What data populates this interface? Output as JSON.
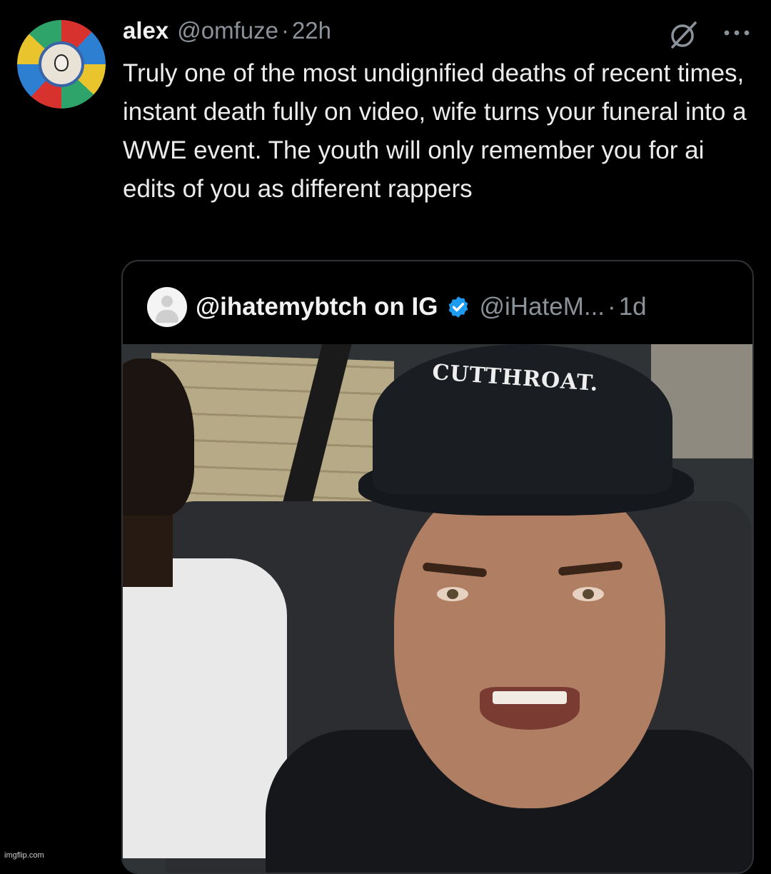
{
  "tweet": {
    "name": "alex",
    "handle": "@omfuze",
    "separator": "·",
    "time": "22h",
    "text": "Truly one of the most undignified deaths of recent times, instant death fully on video, wife turns your funeral into a WWE event. The youth will only remember you for ai edits of you as different rappers"
  },
  "quoted": {
    "name": "@ihatemybtch on IG",
    "handle": "@iHateM...",
    "separator": "·",
    "time": "1d",
    "verified": true,
    "media": {
      "hat_text": "CUTTHROAT."
    }
  },
  "watermark": "imgflip.com",
  "colors": {
    "background": "#000000",
    "text": "#e7e9ea",
    "muted": "#8b9299",
    "verified": "#1d9bf0",
    "border": "#2f3336"
  }
}
